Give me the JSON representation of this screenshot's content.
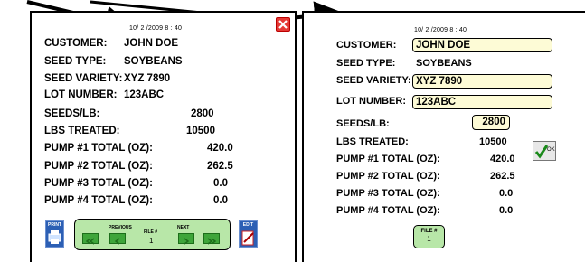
{
  "left_panel": {
    "timestamp": "10/ 2 /2009   8 : 40",
    "customer_label": "CUSTOMER:",
    "customer_value": "JOHN DOE",
    "seed_type_label": "SEED TYPE:",
    "seed_type_value": "SOYBEANS",
    "seed_variety_label": "SEED VARIETY:",
    "seed_variety_value": "XYZ 7890",
    "lot_number_label": "LOT NUMBER:",
    "lot_number_value": "123ABC",
    "seeds_lb_label": "SEEDS/LB:",
    "seeds_lb_value": "2800",
    "lbs_treated_label": "LBS TREATED:",
    "lbs_treated_value": "10500",
    "pumps": [
      {
        "label": "PUMP #1 TOTAL (OZ):",
        "value": "420.0"
      },
      {
        "label": "PUMP #2 TOTAL (OZ):",
        "value": "262.5"
      },
      {
        "label": "PUMP #3 TOTAL (OZ):",
        "value": "0.0"
      },
      {
        "label": "PUMP #4 TOTAL (OZ):",
        "value": "0.0"
      }
    ],
    "print_label": "PRINT",
    "previous_label": "PREVIOUS",
    "file_label": "FILE #",
    "file_number": "1",
    "next_label": "NEXT",
    "edit_label": "EDIT"
  },
  "right_panel": {
    "timestamp": "10/ 2 /2009   8 : 40",
    "customer_label": "CUSTOMER:",
    "customer_value": "JOHN DOE",
    "seed_type_label": "SEED TYPE:",
    "seed_type_value": "SOYBEANS",
    "seed_variety_label": "SEED VARIETY:",
    "seed_variety_value": "XYZ 7890",
    "lot_number_label": "LOT NUMBER:",
    "lot_number_value": "123ABC",
    "seeds_lb_label": "SEEDS/LB:",
    "seeds_lb_value": "2800",
    "lbs_treated_label": "LBS TREATED:",
    "lbs_treated_value": "10500",
    "pumps": [
      {
        "label": "PUMP #1 TOTAL (OZ):",
        "value": "420.0"
      },
      {
        "label": "PUMP #2 TOTAL (OZ):",
        "value": "262.5"
      },
      {
        "label": "PUMP #3 TOTAL (OZ):",
        "value": "0.0"
      },
      {
        "label": "PUMP #4 TOTAL (OZ):",
        "value": "0.0"
      }
    ],
    "ok_label": "OK",
    "file_label": "FILE #",
    "file_number": "1"
  },
  "colors": {
    "field_bg": "#fdfbd6",
    "nav_bg": "#b8e7a8",
    "nav_button": "#3ea53a",
    "close_red": "#e53935",
    "icon_blue": "#2c5fb4"
  }
}
